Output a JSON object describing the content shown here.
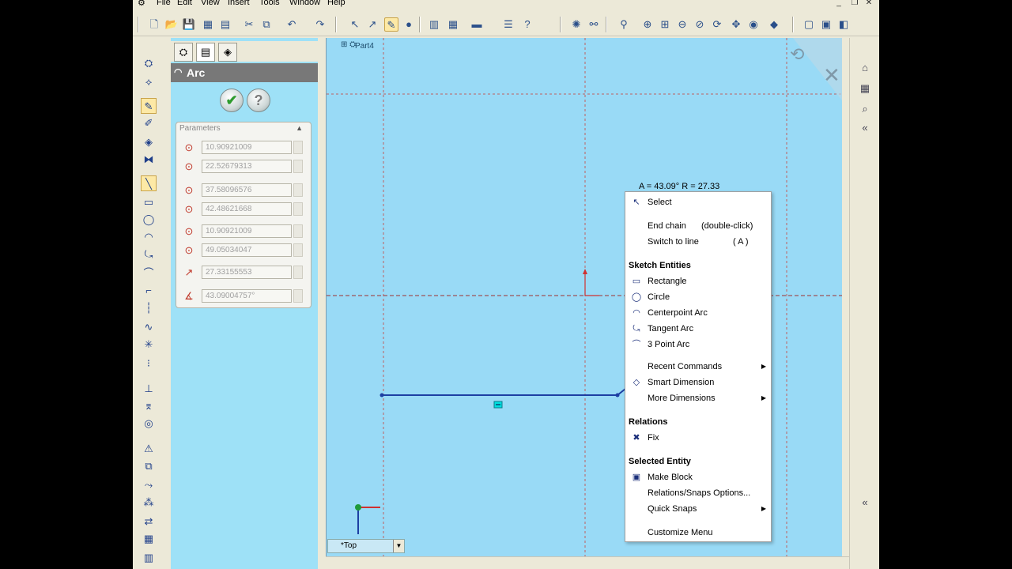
{
  "menubar": {
    "items": [
      "File",
      "Edit",
      "View",
      "Insert",
      "Tools",
      "Window",
      "Help"
    ]
  },
  "feature_tree": {
    "part_name": "Part4"
  },
  "property_manager": {
    "title": "Arc",
    "ok_icon": "check-icon",
    "help_icon": "question-icon",
    "group_title": "Parameters",
    "params": [
      {
        "icon": "center-x-icon",
        "value": "10.90921009"
      },
      {
        "icon": "center-y-icon",
        "value": "22.52679313"
      },
      {
        "icon": "start-x-icon",
        "value": "37.58096576"
      },
      {
        "icon": "start-y-icon",
        "value": "42.48621668"
      },
      {
        "icon": "end-x-icon",
        "value": "10.90921009"
      },
      {
        "icon": "end-y-icon",
        "value": "49.05034047"
      },
      {
        "icon": "radius-icon",
        "value": "27.33155553"
      },
      {
        "icon": "angle-icon",
        "value": "43.09004757°"
      }
    ]
  },
  "canvas": {
    "readout": "A = 43.09° R = 27.33",
    "view_label": "*Top",
    "colors": {
      "background": "#99daf6",
      "sketch_line": "#1d3fa3",
      "grid": "#c04040"
    }
  },
  "context_menu": {
    "items_top": [
      {
        "label": "Select",
        "icon": "cursor-icon"
      },
      {
        "label": "End chain",
        "hint": "(double-click)"
      },
      {
        "label": "Switch to line",
        "hint": "( A )"
      }
    ],
    "sketch_entities_header": "Sketch Entities",
    "sketch_entities": [
      {
        "label": "Rectangle",
        "icon": "rectangle-icon"
      },
      {
        "label": "Circle",
        "icon": "circle-icon"
      },
      {
        "label": "Centerpoint Arc",
        "icon": "centerpoint-arc-icon"
      },
      {
        "label": "Tangent Arc",
        "icon": "tangent-arc-icon"
      },
      {
        "label": "3 Point Arc",
        "icon": "three-point-arc-icon"
      }
    ],
    "commands": [
      {
        "label": "Recent Commands",
        "submenu": true
      },
      {
        "label": "Smart Dimension",
        "icon": "smart-dimension-icon"
      },
      {
        "label": "More Dimensions",
        "submenu": true
      }
    ],
    "relations_header": "Relations",
    "relations": [
      {
        "label": "Fix",
        "icon": "fix-icon"
      }
    ],
    "selected_entity_header": "Selected Entity",
    "selected_entity": [
      {
        "label": "Make Block",
        "icon": "block-icon"
      },
      {
        "label": "Relations/Snaps Options..."
      },
      {
        "label": "Quick Snaps",
        "submenu": true
      }
    ],
    "footer": "Customize Menu"
  }
}
